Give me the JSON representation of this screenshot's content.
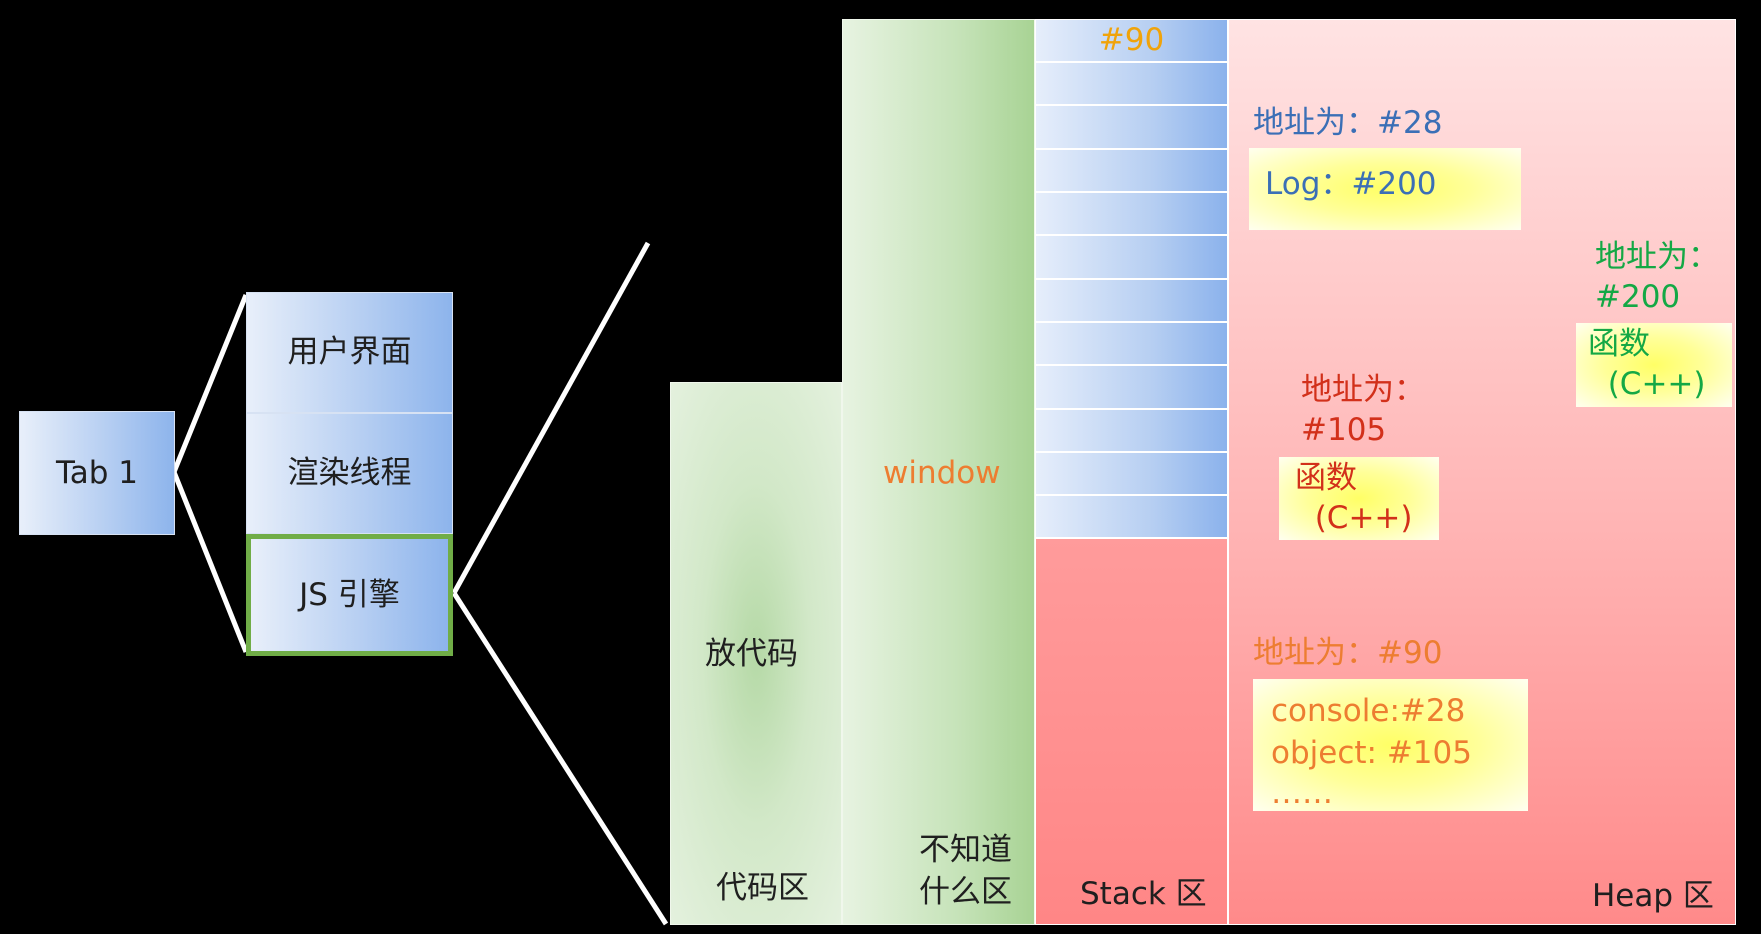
{
  "browser": {
    "tab_label": "Tab 1",
    "components": [
      "用户界面",
      "渲染线程",
      "JS 引擎"
    ]
  },
  "regions": {
    "code_area": {
      "content": "放代码",
      "label": "代码区"
    },
    "unknown_area": {
      "content": "window",
      "label_line1": "不知道",
      "label_line2": "什么区"
    },
    "stack": {
      "top_cell": "#90",
      "label": "Stack 区"
    },
    "heap": {
      "label": "Heap 区"
    }
  },
  "heap_objects": {
    "log_obj": {
      "address": "地址为：#28",
      "content": "Log：#200"
    },
    "func200": {
      "address_line1": "地址为：",
      "address_line2": "#200",
      "content_line1": "函数",
      "content_line2": "  (C++)"
    },
    "func105": {
      "address_line1": "地址为：",
      "address_line2": "#105",
      "content_line1": "函数",
      "content_line2": "  (C++)"
    },
    "window_obj": {
      "address": "地址为：#90",
      "line1": "console:#28",
      "line2": "object: #105",
      "line3": "……"
    }
  },
  "colors": {
    "blue": "#3b6fb6",
    "orange": "#ed7d31",
    "green": "#14a845",
    "red": "#d2301a",
    "amber": "#f0a30a",
    "selected_border": "#70ad47"
  }
}
